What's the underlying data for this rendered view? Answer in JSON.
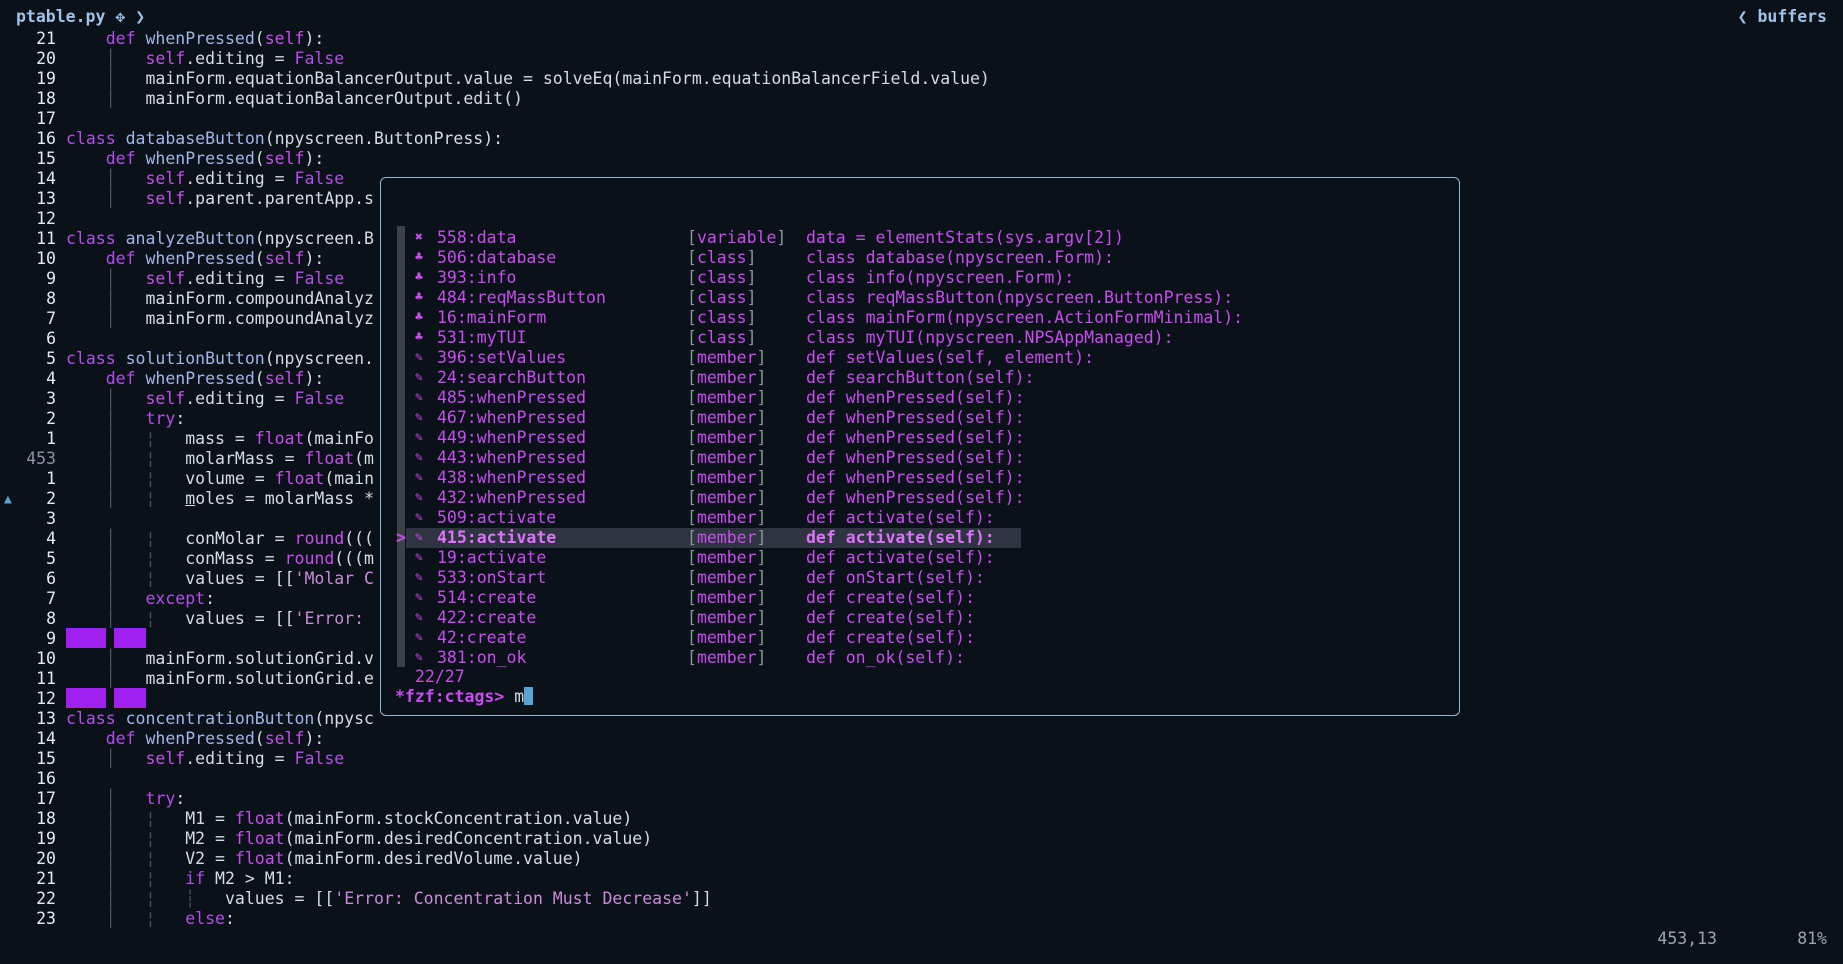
{
  "tab": {
    "filename": "ptable.py",
    "modified_symbol": "✥"
  },
  "buffers_label": "buffers",
  "editor_lines": [
    {
      "n": "21",
      "html": "    <span class='kw'>def</span> <span class='fn'>whenPressed</span>(<span class='sf'>self</span>):"
    },
    {
      "n": "20",
      "html": "    <span class='guide'>│</span>   <span class='sf'>self</span>.editing = <span class='kw'>False</span>"
    },
    {
      "n": "19",
      "html": "    <span class='guide'>│</span>   mainForm.equationBalancerOutput.value = solveEq(mainForm.equationBalancerField.value)"
    },
    {
      "n": "18",
      "html": "    <span class='guide'>│</span>   mainForm.equationBalancerOutput.edit()"
    },
    {
      "n": "17",
      "html": ""
    },
    {
      "n": "16",
      "html": "<span class='kw'>class</span> <span class='fn'>databaseButton</span>(npyscreen.ButtonPress):"
    },
    {
      "n": "15",
      "html": "    <span class='kw'>def</span> <span class='fn'>whenPressed</span>(<span class='sf'>self</span>):"
    },
    {
      "n": "14",
      "html": "    <span class='guide'>│</span>   <span class='sf'>self</span>.editing = <span class='kw'>False</span>"
    },
    {
      "n": "13",
      "html": "    <span class='guide'>│</span>   <span class='sf'>self</span>.parent.parentApp.s"
    },
    {
      "n": "12",
      "html": ""
    },
    {
      "n": "11",
      "html": "<span class='kw'>class</span> <span class='fn'>analyzeButton</span>(npyscreen.B"
    },
    {
      "n": "10",
      "html": "    <span class='kw'>def</span> <span class='fn'>whenPressed</span>(<span class='sf'>self</span>):"
    },
    {
      "n": "9",
      "html": "    <span class='guide'>│</span>   <span class='sf'>self</span>.editing = <span class='kw'>False</span>"
    },
    {
      "n": "8",
      "html": "    <span class='guide'>│</span>   mainForm.compoundAnalyz"
    },
    {
      "n": "7",
      "html": "    <span class='guide'>│</span>   mainForm.compoundAnalyz"
    },
    {
      "n": "6",
      "html": ""
    },
    {
      "n": "5",
      "html": "<span class='kw'>class</span> <span class='fn'>solutionButton</span>(npyscreen."
    },
    {
      "n": "4",
      "html": "    <span class='kw'>def</span> <span class='fn'>whenPressed</span>(<span class='sf'>self</span>):"
    },
    {
      "n": "3",
      "html": "    <span class='guide'>│</span>   <span class='sf'>self</span>.editing = <span class='kw'>False</span>"
    },
    {
      "n": "2",
      "html": "    <span class='guide'>│</span>   <span class='kw'>try</span>:"
    },
    {
      "n": "1",
      "html": "    <span class='guide'>│</span>   <span class='guide'>¦</span>   mass = <span class='bi'>float</span>(mainFo"
    },
    {
      "n": "453",
      "cur": true,
      "html": "    <span class='guide'>│</span>   <span class='guide'>¦</span>   molarMass = <span class='bi'>float</span>(m"
    },
    {
      "n": "1",
      "html": "    <span class='guide'>│</span>   <span class='guide'>¦</span>   volume = <span class='bi'>float</span>(main"
    },
    {
      "n": "2",
      "html": "    <span class='guide'>│</span>   <span class='guide'>¦</span>   <u>m</u>oles = molarMass *"
    },
    {
      "n": "3",
      "html": ""
    },
    {
      "n": "4",
      "html": "    <span class='guide'>│</span>   <span class='guide'>¦</span>   conMolar = <span class='bi'>round</span>((("
    },
    {
      "n": "5",
      "html": "    <span class='guide'>│</span>   <span class='guide'>¦</span>   conMass = <span class='bi'>round</span>(((m"
    },
    {
      "n": "6",
      "html": "    <span class='guide'>│</span>   <span class='guide'>¦</span>   values = [[<span class='st'>'Molar C</span>"
    },
    {
      "n": "7",
      "html": "    <span class='guide'>│</span>   <span class='kw'>except</span>:"
    },
    {
      "n": "8",
      "html": "    <span class='guide'>│</span>   <span class='guide'>¦</span>   values = [[<span class='st'>'Error: </span>"
    },
    {
      "n": "9",
      "html": ""
    },
    {
      "n": "10",
      "html": "    <span class='guide'>│</span>   mainForm.solutionGrid.v"
    },
    {
      "n": "11",
      "html": "    <span class='guide'>│</span>   mainForm.solutionGrid.e"
    },
    {
      "n": "12",
      "html": ""
    },
    {
      "n": "13",
      "html": "<span class='kw'>class</span> <span class='fn'>concentrationButton</span>(npysc"
    },
    {
      "n": "14",
      "html": "    <span class='kw'>def</span> <span class='fn'>whenPressed</span>(<span class='sf'>self</span>):"
    },
    {
      "n": "15",
      "html": "    <span class='guide'>│</span>   <span class='sf'>self</span>.editing = <span class='kw'>False</span>"
    },
    {
      "n": "16",
      "html": ""
    },
    {
      "n": "17",
      "html": "    <span class='guide'>│</span>   <span class='kw'>try</span>:"
    },
    {
      "n": "18",
      "html": "    <span class='guide'>│</span>   <span class='guide'>¦</span>   M1 = <span class='bi'>float</span>(mainForm.stockConcentration.value)"
    },
    {
      "n": "19",
      "html": "    <span class='guide'>│</span>   <span class='guide'>¦</span>   M2 = <span class='bi'>float</span>(mainForm.desiredConcentration.value)"
    },
    {
      "n": "20",
      "html": "    <span class='guide'>│</span>   <span class='guide'>¦</span>   V2 = <span class='bi'>float</span>(mainForm.desiredVolume.value)"
    },
    {
      "n": "21",
      "html": "    <span class='guide'>│</span>   <span class='guide'>¦</span>   <span class='kw'>if</span> M2 > M1:"
    },
    {
      "n": "22",
      "html": "    <span class='guide'>│</span>   <span class='guide'>¦</span>   <span class='guide'>┆</span>   values = [[<span class='st'>'Error: Concentration Must Decrease'</span>]]"
    },
    {
      "n": "23",
      "html": "    <span class='guide'>│</span>   <span class='guide'>¦</span>   <span class='kw'>else</span>:"
    }
  ],
  "fzf": {
    "items": [
      {
        "icon": "✖",
        "name": "558:data",
        "kind": "variable",
        "sig": "data = elementStats(sys.argv[2])"
      },
      {
        "icon": "♣",
        "name": "506:database",
        "kind": "class",
        "sig": "class database(npyscreen.Form):"
      },
      {
        "icon": "♣",
        "name": "393:info",
        "kind": "class",
        "sig": "class info(npyscreen.Form):"
      },
      {
        "icon": "♣",
        "name": "484:reqMassButton",
        "kind": "class",
        "sig": "class reqMassButton(npyscreen.ButtonPress):"
      },
      {
        "icon": "♣",
        "name": "16:mainForm",
        "kind": "class",
        "sig": "class mainForm(npyscreen.ActionFormMinimal):"
      },
      {
        "icon": "♣",
        "name": "531:myTUI",
        "kind": "class",
        "sig": "class myTUI(npyscreen.NPSAppManaged):"
      },
      {
        "icon": "✎",
        "name": "396:setValues",
        "kind": "member",
        "sig": "def setValues(self, element):"
      },
      {
        "icon": "✎",
        "name": "24:searchButton",
        "kind": "member",
        "sig": "def searchButton(self):"
      },
      {
        "icon": "✎",
        "name": "485:whenPressed",
        "kind": "member",
        "sig": "def whenPressed(self):"
      },
      {
        "icon": "✎",
        "name": "467:whenPressed",
        "kind": "member",
        "sig": "def whenPressed(self):"
      },
      {
        "icon": "✎",
        "name": "449:whenPressed",
        "kind": "member",
        "sig": "def whenPressed(self):"
      },
      {
        "icon": "✎",
        "name": "443:whenPressed",
        "kind": "member",
        "sig": "def whenPressed(self):"
      },
      {
        "icon": "✎",
        "name": "438:whenPressed",
        "kind": "member",
        "sig": "def whenPressed(self):"
      },
      {
        "icon": "✎",
        "name": "432:whenPressed",
        "kind": "member",
        "sig": "def whenPressed(self):"
      },
      {
        "icon": "✎",
        "name": "509:activate",
        "kind": "member",
        "sig": "def activate(self):"
      },
      {
        "icon": "✎",
        "name": "415:activate",
        "kind": "member",
        "sig": "def activate(self):",
        "selected": true
      },
      {
        "icon": "✎",
        "name": "19:activate",
        "kind": "member",
        "sig": "def activate(self):"
      },
      {
        "icon": "✎",
        "name": "533:onStart",
        "kind": "member",
        "sig": "def onStart(self):"
      },
      {
        "icon": "✎",
        "name": "514:create",
        "kind": "member",
        "sig": "def create(self):"
      },
      {
        "icon": "✎",
        "name": "422:create",
        "kind": "member",
        "sig": "def create(self):"
      },
      {
        "icon": "✎",
        "name": "42:create",
        "kind": "member",
        "sig": "def create(self):"
      },
      {
        "icon": "✎",
        "name": "381:on_ok",
        "kind": "member",
        "sig": "def on_ok(self):"
      }
    ],
    "count": "22/27",
    "prompt": "*fzf:ctags> ",
    "query": "m",
    "selected_marker": ">"
  },
  "status": {
    "position": "453,13",
    "percent": "81%"
  }
}
